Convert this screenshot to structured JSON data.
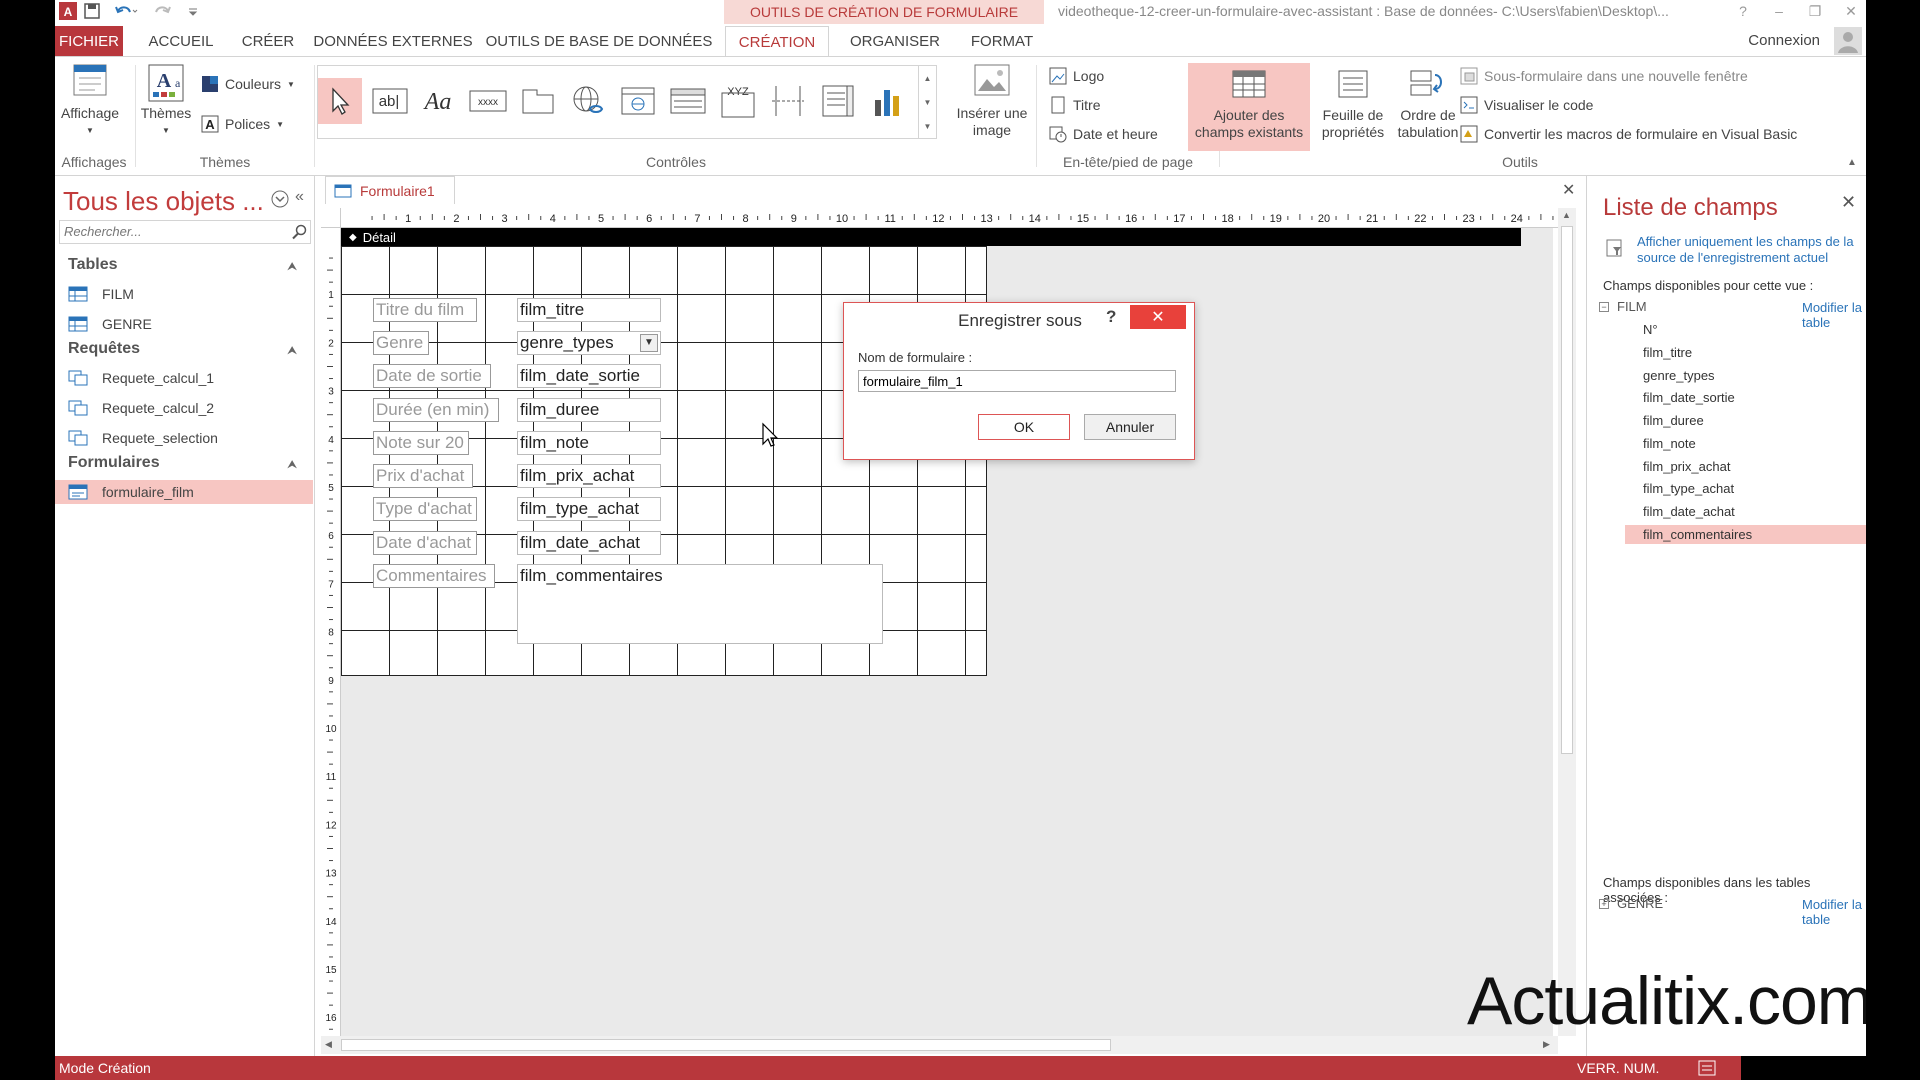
{
  "titlebar": {
    "app_icon": "access-icon",
    "context_tab": "OUTILS DE CRÉATION DE FORMULAIRE",
    "window_title": "videotheque-12-creer-un-formulaire-avec-assistant : Base de données- C:\\Users\\fabien\\Desktop\\...",
    "help": "?",
    "minimize": "–",
    "restore": "❐",
    "close": "✕"
  },
  "tabs": {
    "fichier": "FICHIER",
    "accueil": "ACCUEIL",
    "creer": "CRÉER",
    "donnees_externes": "DONNÉES EXTERNES",
    "outils_bdd": "OUTILS DE BASE DE DONNÉES",
    "creation": "CRÉATION",
    "organiser": "ORGANISER",
    "format": "FORMAT",
    "connexion": "Connexion"
  },
  "ribbon": {
    "affichage": "Affichage",
    "affichages_group": "Affichages",
    "themes": "Thèmes",
    "couleurs": "Couleurs",
    "polices": "Polices",
    "themes_group": "Thèmes",
    "controles_group": "Contrôles",
    "inserer_image_1": "Insérer une",
    "inserer_image_2": "image",
    "logo": "Logo",
    "titre": "Titre",
    "date_heure": "Date et heure",
    "entete_group": "En-tête/pied de page",
    "ajouter_champs_1": "Ajouter des",
    "ajouter_champs_2": "champs existants",
    "feuille_prop_1": "Feuille de",
    "feuille_prop_2": "propriétés",
    "ordre_tab_1": "Ordre de",
    "ordre_tab_2": "tabulation",
    "sous_formulaire": "Sous-formulaire dans une nouvelle fenêtre",
    "visualiser_code": "Visualiser le code",
    "convertir_macros": "Convertir les macros de formulaire en Visual Basic",
    "outils_group": "Outils",
    "text_control_glyph": "ab|",
    "label_control_glyph": "Aa",
    "button_control_glyph": "xxxx",
    "option_group_glyph": "XYZ"
  },
  "nav": {
    "title": "Tous les objets ...",
    "search_placeholder": "Rechercher...",
    "sections": {
      "tables": "Tables",
      "requetes": "Requêtes",
      "formulaires": "Formulaires"
    },
    "tables": [
      "FILM",
      "GENRE"
    ],
    "requetes": [
      "Requete_calcul_1",
      "Requete_calcul_2",
      "Requete_selection"
    ],
    "formulaires": [
      "formulaire_film"
    ]
  },
  "document": {
    "tab_label": "Formulaire1",
    "detail_label": "Détail",
    "ruler_h": [
      "1",
      "2",
      "3",
      "4",
      "5",
      "6",
      "7",
      "8",
      "9",
      "10",
      "11",
      "12",
      "13",
      "14",
      "15",
      "16",
      "17",
      "18",
      "19",
      "20",
      "21",
      "22",
      "23",
      "24"
    ],
    "ruler_v": [
      "1",
      "2",
      "3",
      "4",
      "5",
      "6",
      "7",
      "8",
      "9",
      "10",
      "11",
      "12",
      "13",
      "14",
      "15",
      "16"
    ],
    "labels": [
      "Titre du film",
      "Genre",
      "Date de sortie",
      "Durée (en min)",
      "Note sur 20",
      "Prix d'achat",
      "Type d'achat",
      "Date d'achat",
      "Commentaires"
    ],
    "fields": [
      "film_titre",
      "genre_types",
      "film_date_sortie",
      "film_duree",
      "film_note",
      "film_prix_achat",
      "film_type_achat",
      "film_date_achat",
      "film_commentaires"
    ]
  },
  "dialog": {
    "title": "Enregistrer sous",
    "help": "?",
    "close": "✕",
    "label": "Nom de formulaire :",
    "input_value": "formulaire_film_1",
    "ok": "OK",
    "cancel": "Annuler"
  },
  "fieldlist": {
    "title": "Liste de champs",
    "show_only": "Afficher uniquement les champs de la source de l'enregistrement actuel",
    "available_view": "Champs disponibles pour cette vue :",
    "table_name": "FILM",
    "modify_table": "Modifier la table",
    "fields": [
      "N°",
      "film_titre",
      "genre_types",
      "film_date_sortie",
      "film_duree",
      "film_note",
      "film_prix_achat",
      "film_type_achat",
      "film_date_achat",
      "film_commentaires"
    ],
    "selected_index": 9,
    "available_related": "Champs disponibles dans les tables associées :",
    "related_table": "GENRE",
    "modify_table_2": "Modifier la table"
  },
  "watermark": "Actualitix.com",
  "status": {
    "mode": "Mode Création",
    "num": "VERR. NUM."
  },
  "colors": {
    "accent": "#b8373c",
    "highlight": "#f7c6c2",
    "link": "#2a73b8"
  }
}
